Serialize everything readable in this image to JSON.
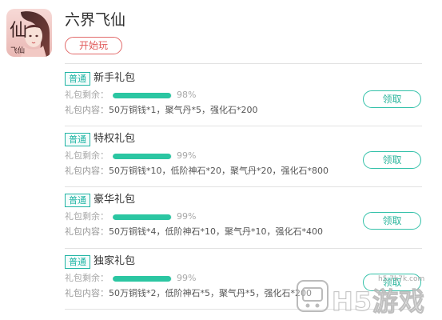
{
  "game": {
    "title": "六界飞仙",
    "start_button": "开始玩",
    "icon_name": "game-character-icon",
    "icon_text": "仙"
  },
  "packs": [
    {
      "tag": "普通",
      "name": "新手礼包",
      "remain_label": "礼包剩余：",
      "percent": 98,
      "percent_text": "98%",
      "content_label": "礼包内容：",
      "content": "50万铜钱*1，聚气丹*5，强化石*200",
      "claim": "领取"
    },
    {
      "tag": "普通",
      "name": "特权礼包",
      "remain_label": "礼包剩余：",
      "percent": 99,
      "percent_text": "99%",
      "content_label": "礼包内容：",
      "content": "50万铜钱*10，低阶神石*20，聚气丹*20，强化石*800",
      "claim": "领取"
    },
    {
      "tag": "普通",
      "name": "豪华礼包",
      "remain_label": "礼包剩余：",
      "percent": 99,
      "percent_text": "99%",
      "content_label": "礼包内容：",
      "content": "50万铜钱*4，低阶神石*10，聚气丹*10，强化石*400",
      "claim": "领取"
    },
    {
      "tag": "普通",
      "name": "独家礼包",
      "remain_label": "礼包剩余：",
      "percent": 99,
      "percent_text": "99%",
      "content_label": "礼包内容：",
      "content": "50万铜钱*2，低阶神石*5，聚气丹*5，强化石*200",
      "claim": "领取"
    }
  ],
  "watermark": {
    "url": "h5.7k7k.com",
    "brand": "H5游戏"
  },
  "colors": {
    "accent_teal": "#2bc6a2",
    "start_red": "#e05858",
    "divider": "#e2e2e2"
  }
}
